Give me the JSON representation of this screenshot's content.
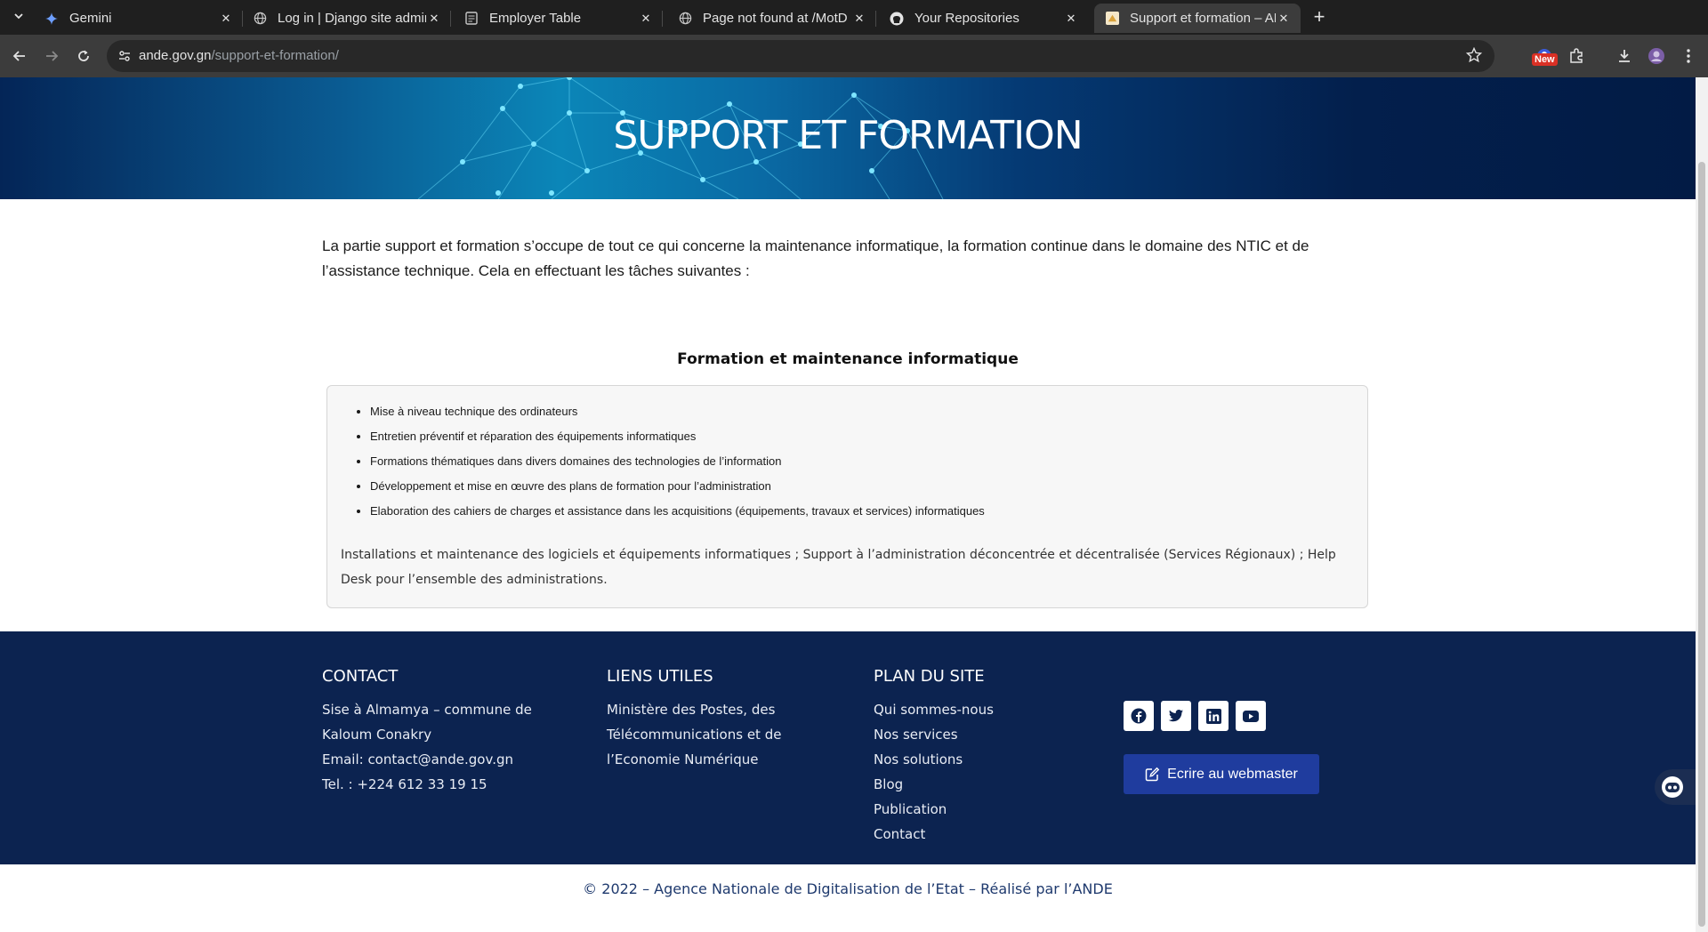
{
  "browser": {
    "tabs": [
      {
        "title": "Gemini",
        "icon": "gemini-icon"
      },
      {
        "title": "Log in | Django site admin",
        "icon": "globe-icon"
      },
      {
        "title": "Employer Table",
        "icon": "document-icon"
      },
      {
        "title": "Page not found at /MotD",
        "icon": "globe-icon"
      },
      {
        "title": "Your Repositories",
        "icon": "github-icon"
      },
      {
        "title": "Support et formation – ANDE",
        "icon": "site-favicon"
      }
    ],
    "active_tab": 5,
    "url_host": "ande.gov.gn",
    "url_path": "/support-et-formation/",
    "new_badge": "New"
  },
  "hero": {
    "title": "SUPPORT ET FORMATION"
  },
  "intro": "La partie support et formation s’occupe de tout ce qui concerne la maintenance informatique, la formation continue dans le domaine des NTIC et de l’assistance technique. Cela en effectuant les tâches suivantes :",
  "section": {
    "title": "Formation et maintenance informatique",
    "items": [
      "Mise à niveau technique des ordinateurs",
      "Entretien préventif et réparation des équipements informatiques",
      "Formations thématiques dans divers domaines des technologies de l’information",
      "Développement et mise en œuvre des plans de formation pour l’administration",
      "Elaboration des cahiers de charges et assistance dans les acquisitions (équipements, travaux et services) informatiques"
    ],
    "note": "Installations et maintenance des logiciels et équipements informatiques ; Support à l’administration déconcentrée et décentralisée (Services Régionaux) ; Help Desk pour l’ensemble des administrations."
  },
  "footer": {
    "contact": {
      "title": "CONTACT",
      "lines": [
        "Sise à Almamya – commune de",
        "Kaloum Conakry",
        "Email: contact@ande.gov.gn",
        "Tel. : +224 612 33 19 15"
      ]
    },
    "liens": {
      "title": "LIENS UTILES",
      "lines": [
        "Ministère des Postes, des",
        "Télécommunications et de",
        "l’Economie Numérique"
      ]
    },
    "plan": {
      "title": "PLAN DU SITE",
      "links": [
        "Qui sommes-nous",
        "Nos services",
        "Nos solutions",
        "Blog",
        "Publication",
        "Contact"
      ]
    },
    "social": [
      "facebook-icon",
      "twitter-icon",
      "linkedin-icon",
      "youtube-icon"
    ],
    "webmaster_label": "Ecrire au webmaster"
  },
  "copyright": "© 2022 – Agence Nationale de Digitalisation de l’Etat – Réalisé par l’ANDE",
  "colors": {
    "footer_bg": "#0c2350",
    "button_bg": "#1f3c9e",
    "hero_accent": "#0b86b8"
  }
}
